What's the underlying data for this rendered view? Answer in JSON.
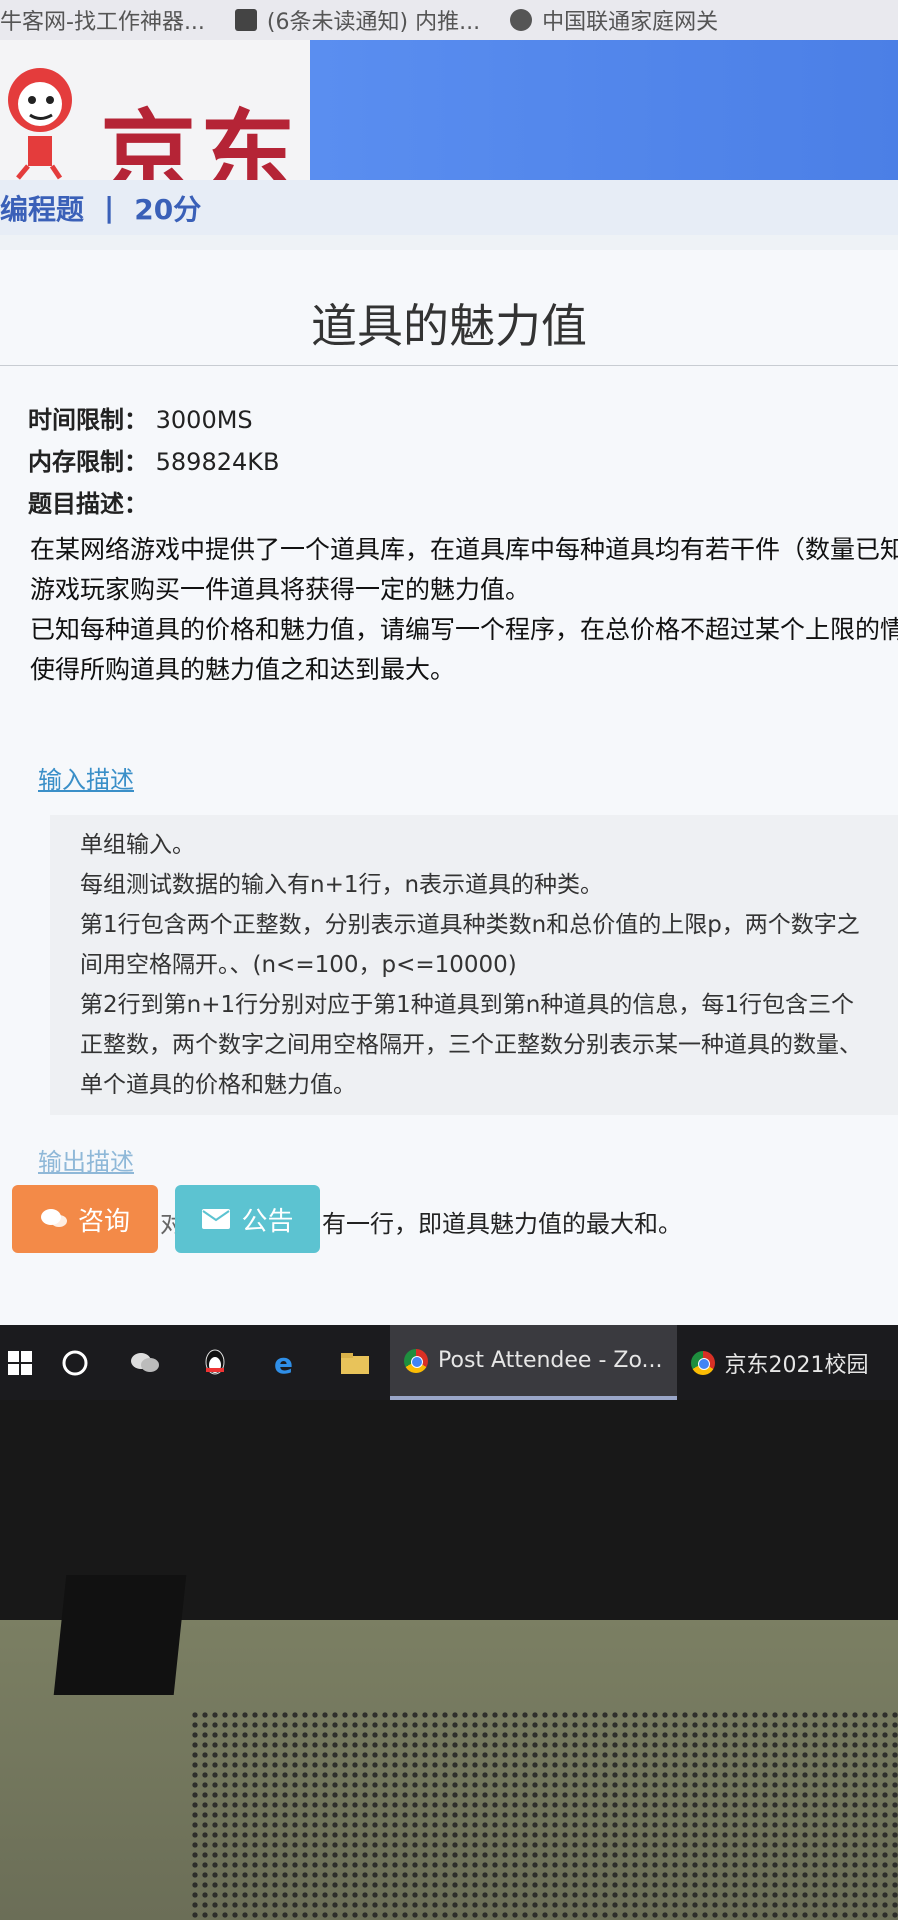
{
  "browser": {
    "bookmarks": [
      {
        "label": "牛客网-找工作神器...",
        "icon": "site-icon"
      },
      {
        "label": "(6条未读通知) 内推...",
        "icon": "bookmark-icon"
      },
      {
        "label": "中国联通家庭网关",
        "icon": "globe-icon"
      }
    ]
  },
  "header": {
    "logo_text": "京东",
    "problem_type": "编程题",
    "separator": "|",
    "score": "20分"
  },
  "problem": {
    "title": "道具的魅力值",
    "time_limit_label": "时间限制：",
    "time_limit_value": "3000MS",
    "memory_limit_label": "内存限制：",
    "memory_limit_value": "589824KB",
    "desc_label": "题目描述：",
    "desc_lines": [
      "在某网络游戏中提供了一个道具库，在道具库中每种道具均有若干件（数量已知",
      "游戏玩家购买一件道具将获得一定的魅力值。",
      "已知每种道具的价格和魅力值，请编写一个程序，在总价格不超过某个上限的情",
      "使得所购道具的魅力值之和达到最大。"
    ]
  },
  "input_section": {
    "label": "输入描述",
    "lines": [
      "单组输入。",
      "每组测试数据的输入有n+1行，n表示道具的种类。",
      "第1行包含两个正整数，分别表示道具种类数n和总价值的上限p，两个数字之",
      "间用空格隔开。、(n<=100，p<=10000)",
      "第2行到第n+1行分别对应于第1种道具到第n种道具的信息，每1行包含三个",
      "正整数，两个数字之间用空格隔开，三个正整数分别表示某一种道具的数量、",
      "单个道具的价格和魅力值。"
    ]
  },
  "output_section": {
    "label": "输出描述",
    "prefix": "对",
    "text": "有一行，即道具魅力值的最大和。"
  },
  "buttons": {
    "consult": "咨询",
    "notice": "公告"
  },
  "taskbar": {
    "apps": [
      {
        "label": "Post Attendee - Zo...",
        "active": true
      },
      {
        "label": "京东2021校园",
        "active": false
      }
    ]
  }
}
